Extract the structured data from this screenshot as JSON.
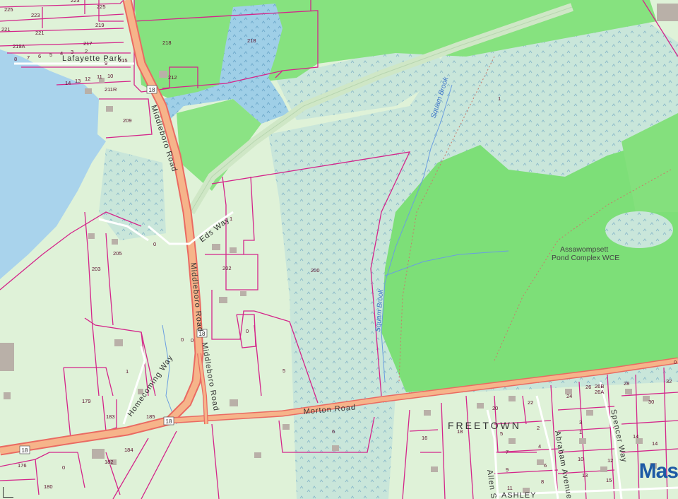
{
  "map": {
    "roads": {
      "middleboro_upper": "Middleboro Road",
      "middleboro_middle": "Middleboro Road",
      "middleboro_lower": "Middleboro Road",
      "morton": "Morton Road",
      "eds_way": "Eds Way",
      "homecoming_way": "Homecoming Way",
      "lafayette_park": "Lafayette Park",
      "spencer_way": "Spencer Way",
      "abraham_avenue": "Abraham Avenue",
      "allen_st": "Allen St",
      "ashley": "ASHLEY"
    },
    "route_shields": [
      "18",
      "18",
      "18",
      "18"
    ],
    "water_labels": {
      "squam_brook_north": "Squam Brook",
      "squam_brook_south": "Squam Brook"
    },
    "area_label_line1": "Assawompsett",
    "area_label_line2": "Pond Complex WCE",
    "town_label": "FREETOWN",
    "brand": "Mas",
    "parcels": {
      "p225a": "225",
      "p223a": "223",
      "p225b": "225",
      "p223b": "223",
      "p221a": "221",
      "p219": "219",
      "p221b": "221",
      "p217": "217",
      "p219a": "219A",
      "p218a": "218",
      "p218b": "218",
      "p215": "215",
      "p212": "212",
      "p211r": "211R",
      "p209": "209",
      "p1_ne": "1",
      "p1_eds": "1",
      "p202": "202",
      "p200": "200",
      "p205": "205",
      "p203": "203",
      "p0_a": "0",
      "p0_b": "0",
      "p0_c": "0",
      "p0_d": "0",
      "p5": "5",
      "p1_home": "1",
      "p179": "179",
      "p183": "183",
      "p185": "185",
      "p184": "184",
      "p182": "182",
      "p176": "176",
      "p0_e": "0",
      "p180": "180",
      "p6": "6",
      "p16": "16",
      "p18": "18",
      "p20": "20",
      "p22": "22",
      "p24": "24",
      "p26": "26",
      "p26b": "26B",
      "p26a": "26A",
      "p28": "28",
      "p32": "32",
      "p30": "30",
      "p14": "14",
      "p0_z": "0",
      "lf_7": "7",
      "lf_6": "6",
      "lf_9": "9",
      "lf_5": "5",
      "lf_4": "4",
      "lf_3": "3",
      "lf_2": "2",
      "lf_14": "14",
      "lf_13": "13",
      "lf_12": "12",
      "lf_11": "11",
      "lf_10": "10",
      "lf_9b": "9",
      "lf_8": "8",
      "fr_5": "5",
      "fr_2": "2",
      "fr_3": "3",
      "fr_4": "4",
      "fr_7": "7",
      "fr_6": "6",
      "fr_8": "8",
      "fr_1": "1",
      "fr_9": "9",
      "fr_11": "11",
      "fr_10": "10",
      "fr_12": "12",
      "fr_13": "13",
      "fr_14": "14",
      "fr_15": "15"
    }
  },
  "colors": {
    "background": "#dff2d8",
    "lake": "#a9d3ec",
    "wetland": "#c6e6dc",
    "forest": "#7fe07a",
    "parcel_line": "#d4258a",
    "road_fill": "#f6b48a",
    "road_edge": "#ea6a62",
    "brand": "#1d5aa5"
  }
}
